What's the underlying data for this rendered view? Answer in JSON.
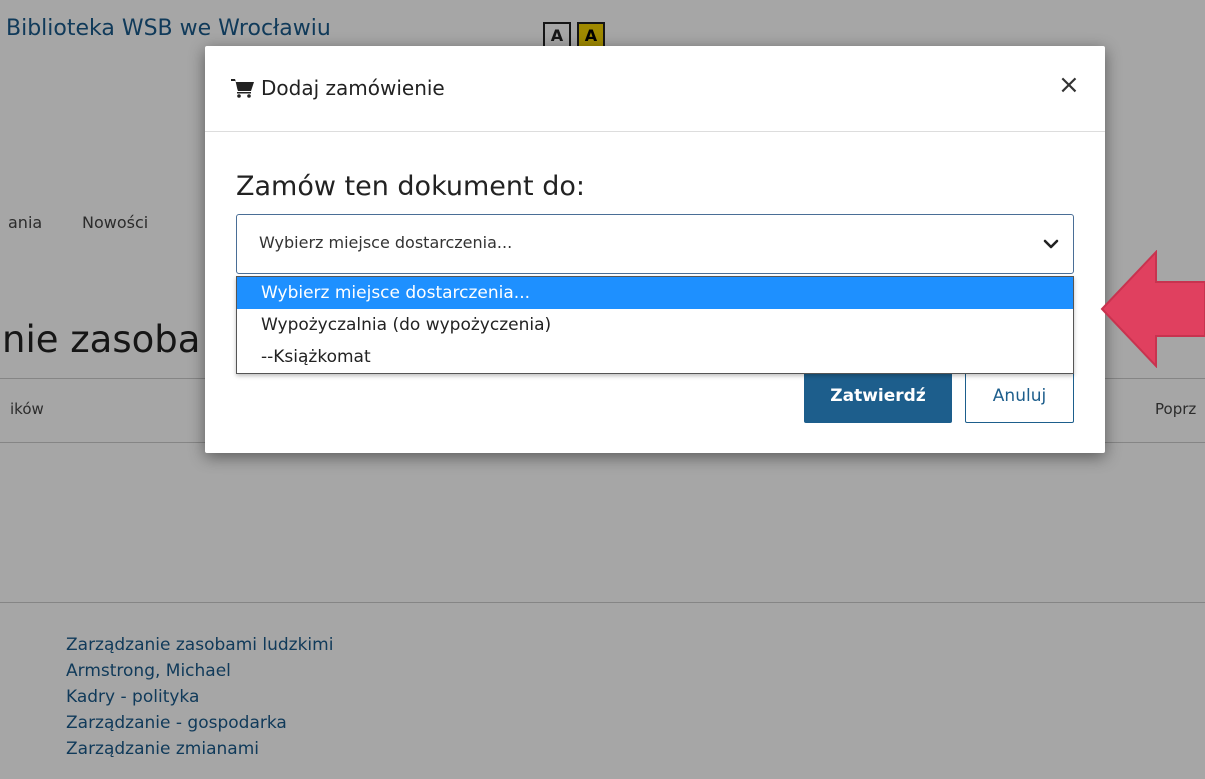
{
  "background_page": {
    "site_title": "Biblioteka WSB we Wrocławiu",
    "contrast_buttons": [
      "A",
      "A"
    ],
    "nav_items": [
      "ania",
      "Nowości"
    ],
    "heading": "nie zasoba",
    "sort_left": "ików",
    "sort_right": "Poprz",
    "subjects": [
      "Zarządzanie zasobami ludzkimi",
      "Armstrong, Michael",
      "Kadry - polityka",
      "Zarządzanie - gospodarka",
      "Zarządzanie zmianami"
    ]
  },
  "modal": {
    "title": "Dodaj zamówienie",
    "title_icon": "cart-icon",
    "close_label": "×",
    "label": "Zamów ten dokument do:",
    "select": {
      "value": "Wybierz miejsce dostarczenia...",
      "options": [
        "Wybierz miejsce dostarczenia...",
        "Wypożyczalnia (do wypożyczenia)",
        "--Książkomat"
      ],
      "selected_index": 0
    },
    "confirm_label": "Zatwierdź",
    "cancel_label": "Anuluj"
  },
  "colors": {
    "primary": "#1d5e8c",
    "highlight": "#1e90ff",
    "arrow": "#e0405f",
    "contrast_yellow": "#f5d300"
  }
}
